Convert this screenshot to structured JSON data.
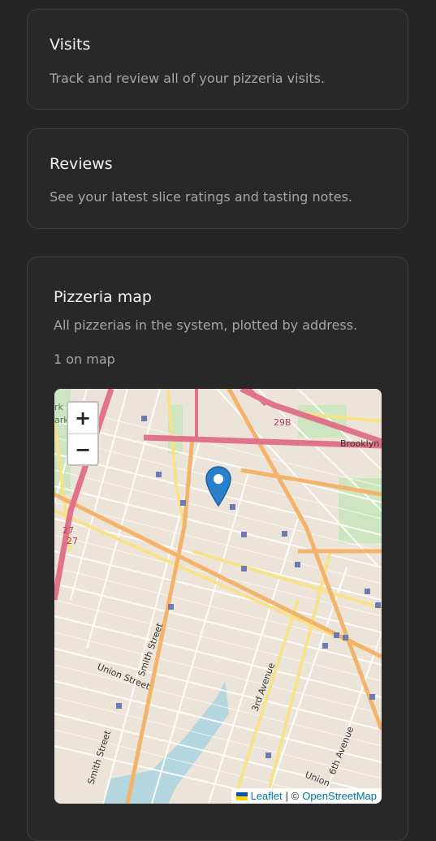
{
  "cards": {
    "visits": {
      "title": "Visits",
      "description": "Track and review all of your pizzeria visits."
    },
    "reviews": {
      "title": "Reviews",
      "description": "See your latest slice ratings and tasting notes."
    },
    "map": {
      "title": "Pizzeria map",
      "description": "All pizzerias in the system, plotted by address.",
      "count_label": "1 on map"
    }
  },
  "map": {
    "zoom_in": "+",
    "zoom_out": "−",
    "attribution": {
      "leaflet": "Leaflet",
      "separator": "| ©",
      "osm": "OpenStreetMap"
    },
    "labels": {
      "smith_street": "Smith Street",
      "union_street": "Union Street",
      "smith_street_2": "Smith Street",
      "third_avenue": "3rd Avenue",
      "sixth_avenue": "6th Avenue",
      "union_2": "Union",
      "brooklyn": "Brooklyn",
      "route_29b": "29B",
      "route_27a": "27",
      "route_27b": "27",
      "park_a": "rk",
      "park_b": "ark"
    },
    "marker_icon": "map-pin-icon"
  },
  "colors": {
    "background": "#262626",
    "card_border": "#3d3d3d",
    "marker": "#2a81cb"
  }
}
